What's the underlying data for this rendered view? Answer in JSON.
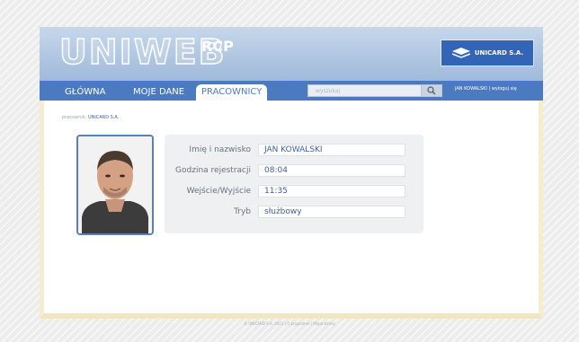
{
  "header": {
    "logo": "UNIWEB",
    "logo_sup": "RCP",
    "brand": "UNICARD S.A."
  },
  "nav": {
    "tabs": [
      {
        "label": "GŁÓWNA"
      },
      {
        "label": "MOJE DANE"
      },
      {
        "label": "PRACOWNICY"
      }
    ],
    "active_tab": "PRACOWNICY",
    "search_placeholder": "wyszukaj",
    "user": "JAN KOWALSKI",
    "logout": "wyloguj się"
  },
  "breadcrumb": {
    "prefix": "pracownik:",
    "company": "UNICARD S.A."
  },
  "employee": {
    "fields": [
      {
        "label": "Imię i nazwisko",
        "value": "JAN KOWALSKI"
      },
      {
        "label": "Godzina rejestracji",
        "value": "08:04"
      },
      {
        "label": "Wejście/Wyjście",
        "value": "11:35"
      },
      {
        "label": "Tryb",
        "value": "służbowy"
      }
    ]
  },
  "footer": {
    "text": "© UNICARD S.A. 2013 | O programie | Mapa strony"
  },
  "colors": {
    "accent": "#4c7ac0",
    "brand": "#3264b8",
    "value_text": "#3d5f9e"
  }
}
